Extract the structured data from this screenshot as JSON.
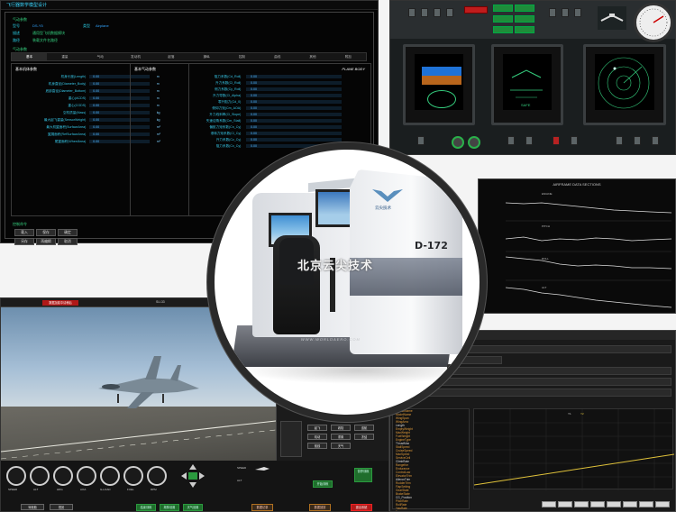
{
  "panel1": {
    "title": "飞行器数学模型设计",
    "model_label": "型号",
    "model_value": "DS-Y5",
    "model2_label": "类型",
    "model2_value": "Airplane",
    "desc_label": "描述",
    "desc_value": "通用型飞机数据模块",
    "file_label": "路径",
    "file_value": "装载文件名路径",
    "section_label": "气动参数",
    "tabs": [
      "基本",
      "重量",
      "气动",
      "发动机",
      "起落",
      "操纵",
      "控制",
      "曲线",
      "其他",
      "附加"
    ],
    "left_header": "基本机体参数",
    "right_header": "基本气动参数",
    "body_tag": "PLANE BODY",
    "left_rows": [
      {
        "k": "机身长度(Length)",
        "n": "0.00",
        "u": "m"
      },
      {
        "k": "机身直径(Diameter_Body)",
        "n": "0.00",
        "u": "m"
      },
      {
        "k": "底部直径(Diameter_Bottom)",
        "n": "0.00",
        "u": "m"
      },
      {
        "k": "重心(ACDS)",
        "n": "0.00",
        "u": "m"
      },
      {
        "k": "重心(CGDS)",
        "n": "0.00",
        "u": "m"
      },
      {
        "k": "空机质量(Mass)",
        "n": "0.00",
        "u": "kg"
      },
      {
        "k": "最大起飞重量(SensorWeight)",
        "n": "0.00",
        "u": "kg"
      },
      {
        "k": "最大机翼面积(SurfaceArea)",
        "n": "0.00",
        "u": "m²"
      },
      {
        "k": "翼展面积(RefSurfaceArea)",
        "n": "0.00",
        "u": "m²"
      },
      {
        "k": "尾翼面积(WheelArea)",
        "n": "0.00",
        "u": "m²"
      }
    ],
    "right_rows": [
      {
        "k": "阻力系数(Cd_Roll)",
        "n": "0.00"
      },
      {
        "k": "升力系数(Cl_Roll)",
        "n": "0.00"
      },
      {
        "k": "侧力系数(Cy_Roll)",
        "n": "0.00"
      },
      {
        "k": "升力导数(Cl_Alpha)",
        "n": "0.00"
      },
      {
        "k": "零升阻力(Cd_0)",
        "n": "0.00"
      },
      {
        "k": "俯仰力矩(Cm_AOA)",
        "n": "0.00"
      },
      {
        "k": "升力线斜率(Cl_Slope)",
        "n": "0.00"
      },
      {
        "k": "失速迎角系数(Cm_Stall)",
        "n": "0.00"
      },
      {
        "k": "偏航力矩系数(Cn_Cy)",
        "n": "0.00"
      },
      {
        "k": "滚转力矩系数(Cl_Cy)",
        "n": "0.00"
      },
      {
        "k": "升力系数(Cz_Cy)",
        "n": "0.00"
      },
      {
        "k": "阻力系数(Cx_Cy)",
        "n": "0.00"
      }
    ],
    "footer_label": "控制命令",
    "buttons": [
      "载入",
      "保存",
      "确定",
      "另存",
      "再编辑",
      "取消"
    ]
  },
  "panel3": {
    "title": "AIRFRAME DATA SECTIONS",
    "labels": [
      "ENGINE",
      "PITCH",
      "ROLL",
      "ALT"
    ]
  },
  "panel4": {
    "red_button": "数据加载中请稍后",
    "callsign": "SU-33",
    "right_buttons": [
      "起飞",
      "着陆",
      "巡航",
      "机动",
      "重置",
      "冻结",
      "航线",
      "天气"
    ],
    "dial_labels": [
      "SPEED",
      "ALT",
      "HDG",
      "AOA",
      "G-LOAD",
      "FUEL",
      "RPM"
    ],
    "bottom_green": [
      "开始训练",
      "暂停训练",
      "结束训练"
    ],
    "bottom_mid": [
      "故障设置",
      "天气设置"
    ],
    "bottom_orange": [
      "数据记录",
      "数据回放"
    ],
    "red_right": "退出系统",
    "bottom_left": [
      "驾驶舱",
      "视景",
      "外部视角"
    ],
    "speed_label": "SPEED",
    "alt_label": "ALT"
  },
  "panel5": {
    "title": "test20190610",
    "list": [
      "AircraftName",
      "ModelName",
      "WingSpan",
      "WingArea",
      "Length",
      "EmptyWeight",
      "MaxWeight",
      "FuelWeight",
      "EngineType",
      "ThrustMax",
      "StallSpeed",
      "CruiseSpeed",
      "MaxSpeed",
      "ServiceCeil",
      "ClimbRate",
      "RangeKm",
      "Endurance",
      "ControlLaw",
      "ElevatorTrim",
      "AileronTrim",
      "RudderTrim",
      "FlapSetting",
      "GearState",
      "BrakeState",
      "CG_Position",
      "PitchRate",
      "RollRate",
      "YawRate",
      "Nz",
      "Ny"
    ],
    "legend": [
      "Y1",
      "Y2"
    ],
    "bottom_buttons": [
      "",
      "",
      "",
      "",
      "",
      "",
      "",
      "",
      ""
    ]
  },
  "center": {
    "logo": "WORLD",
    "logo_text": "云尖技术",
    "model": "D-172",
    "watermark": "北京云尖技术",
    "url": "WWW.WORLDAERO.COM"
  },
  "colors": {
    "cyan": "#2bd0e8",
    "green": "#35d07f",
    "red": "#b01818",
    "orange": "#e09a3a"
  }
}
